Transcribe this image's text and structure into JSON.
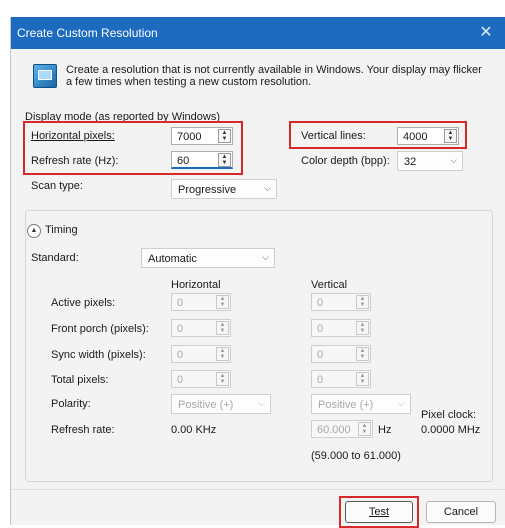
{
  "window": {
    "title": "Create Custom Resolution",
    "close_glyph": "✕"
  },
  "info": {
    "text": "Create a resolution that is not currently available in Windows. Your display may flicker a few times when testing a new custom resolution.",
    "icon": "monitor-icon"
  },
  "display_mode": {
    "group_label": "Display mode (as reported by Windows)",
    "horizontal_pixels": {
      "label": "Horizontal pixels:",
      "value": "7000"
    },
    "vertical_lines": {
      "label": "Vertical lines:",
      "value": "4000"
    },
    "refresh_rate": {
      "label": "Refresh rate (Hz):",
      "value": "60"
    },
    "color_depth": {
      "label": "Color depth (bpp):",
      "value": "32"
    },
    "scan_type": {
      "label": "Scan type:",
      "value": "Progressive"
    }
  },
  "timing": {
    "toggle_label": "Timing",
    "standard_label": "Standard:",
    "standard_value": "Automatic",
    "col_horizontal": "Horizontal",
    "col_vertical": "Vertical",
    "rows": [
      {
        "label": "Active pixels:",
        "h": "0",
        "v": "0"
      },
      {
        "label": "Front porch (pixels):",
        "h": "0",
        "v": "0"
      },
      {
        "label": "Sync width (pixels):",
        "h": "0",
        "v": "0"
      },
      {
        "label": "Total pixels:",
        "h": "0",
        "v": "0"
      }
    ],
    "polarity_label": "Polarity:",
    "polarity_h": "Positive (+)",
    "polarity_v": "Positive (+)",
    "refresh_rate_label": "Refresh rate:",
    "h_refresh": "0.00 KHz",
    "v_refresh": "60.000",
    "v_refresh_unit": "Hz",
    "v_range": "(59.000 to 61.000)",
    "pixel_clock_label": "Pixel clock:",
    "pixel_clock_value": "0.0000 MHz"
  },
  "buttons": {
    "test": "Test",
    "cancel": "Cancel"
  },
  "accent_colors": {
    "titlebar": "#1d6bbf",
    "highlight": "#d62a2a"
  }
}
